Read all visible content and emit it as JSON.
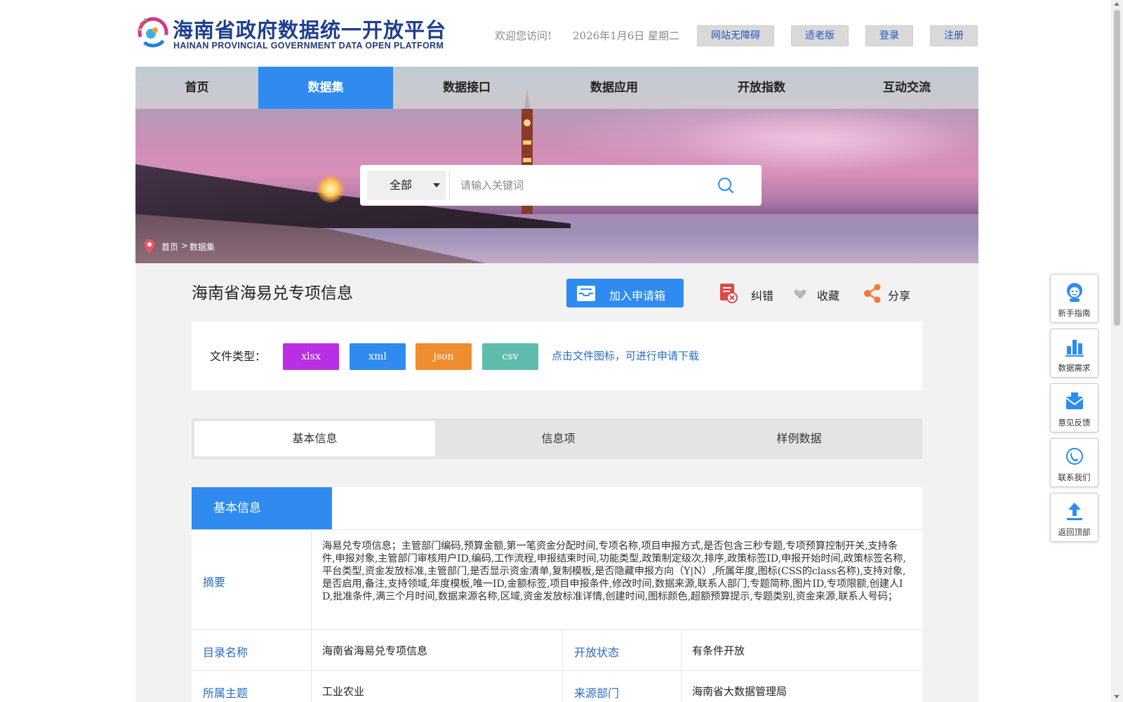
{
  "header": {
    "logo_cn": "海南省政府数据统一开放平台",
    "logo_en": "HAINAN PROVINCIAL GOVERNMENT DATA OPEN PLATFORM",
    "welcome": "欢迎您访问!",
    "date": "2026年1月6日  星期二",
    "buttons": {
      "accessible": "网站无障碍",
      "elderly": "适老版",
      "login": "登录",
      "register": "注册"
    }
  },
  "nav": {
    "items": [
      {
        "label": "首页"
      },
      {
        "label": "数据集"
      },
      {
        "label": "数据接口"
      },
      {
        "label": "数据应用"
      },
      {
        "label": "开放指数"
      },
      {
        "label": "互动交流"
      }
    ],
    "active": "数据集"
  },
  "search": {
    "scope": "全部",
    "placeholder": "请输入关键词",
    "value": ""
  },
  "breadcrumb": {
    "home": "首页",
    "separator": ">",
    "current": "数据集"
  },
  "dataset": {
    "title": "海南省海易兑专项信息",
    "apply_label": "加入申请箱",
    "actions": {
      "report": "纠错",
      "favorite": "收藏",
      "share": "分享"
    }
  },
  "files": {
    "label": "文件类型：",
    "types": [
      {
        "label": "xlsx",
        "color": "#b92fe5"
      },
      {
        "label": "xml",
        "color": "#2f8bf0"
      },
      {
        "label": "json",
        "color": "#f08c30"
      },
      {
        "label": "csv",
        "color": "#5fbcad"
      }
    ],
    "hint": "点击文件图标，可进行申请下载"
  },
  "tabs": [
    {
      "label": "基本信息"
    },
    {
      "label": "信息项"
    },
    {
      "label": "样例数据"
    }
  ],
  "active_tab": "基本信息",
  "info": {
    "heading": "基本信息",
    "abstract_label": "摘要",
    "abstract": "海易兑专项信息；主管部门编码,预算金额,第一笔资金分配时间,专项名称,项目申报方式,是否包含三秒专题,专项预算控制开关,支持条件,申报对象,主管部门审核用户ID,编码,工作流程,申报结束时间,功能类型,政策制定级次,排序,政策标签ID,申报开始时间,政策标签名称,平台类型,资金发放标准,主管部门,是否显示资金清单,复制模板,是否隐藏申报方向（Y|N）,所属年度,图标(CSS的class名称),支持对象,是否启用,备注,支持领域,年度模板,唯一ID,金额标签,项目申报条件,修改时间,数据来源,联系人部门,专题简称,图片ID,专项限额,创建人ID,批准条件,满三个月时间,数据来源名称,区域,资金发放标准详情,创建时间,图标颜色,超额预算提示,专题类别,资金来源,联系人号码；",
    "rows": [
      {
        "k1": "目录名称",
        "v1": "海南省海易兑专项信息",
        "k2": "开放状态",
        "v2": "有条件开放"
      },
      {
        "k1": "所属主题",
        "v1": "工业农业",
        "k2": "来源部门",
        "v2": "海南省大数据管理局"
      }
    ]
  },
  "float_panel": [
    {
      "label": "新手指南",
      "icon": "guide-icon"
    },
    {
      "label": "数据需求",
      "icon": "bar-chart-icon"
    },
    {
      "label": "意见反馈",
      "icon": "mail-icon"
    },
    {
      "label": "联系我们",
      "icon": "phone-icon"
    },
    {
      "label": "返回顶部",
      "icon": "upload-arrow-icon"
    }
  ],
  "colors": {
    "primary": "#2f8bf0",
    "link": "#2a6cc0",
    "logo": "#1d3f8f"
  }
}
